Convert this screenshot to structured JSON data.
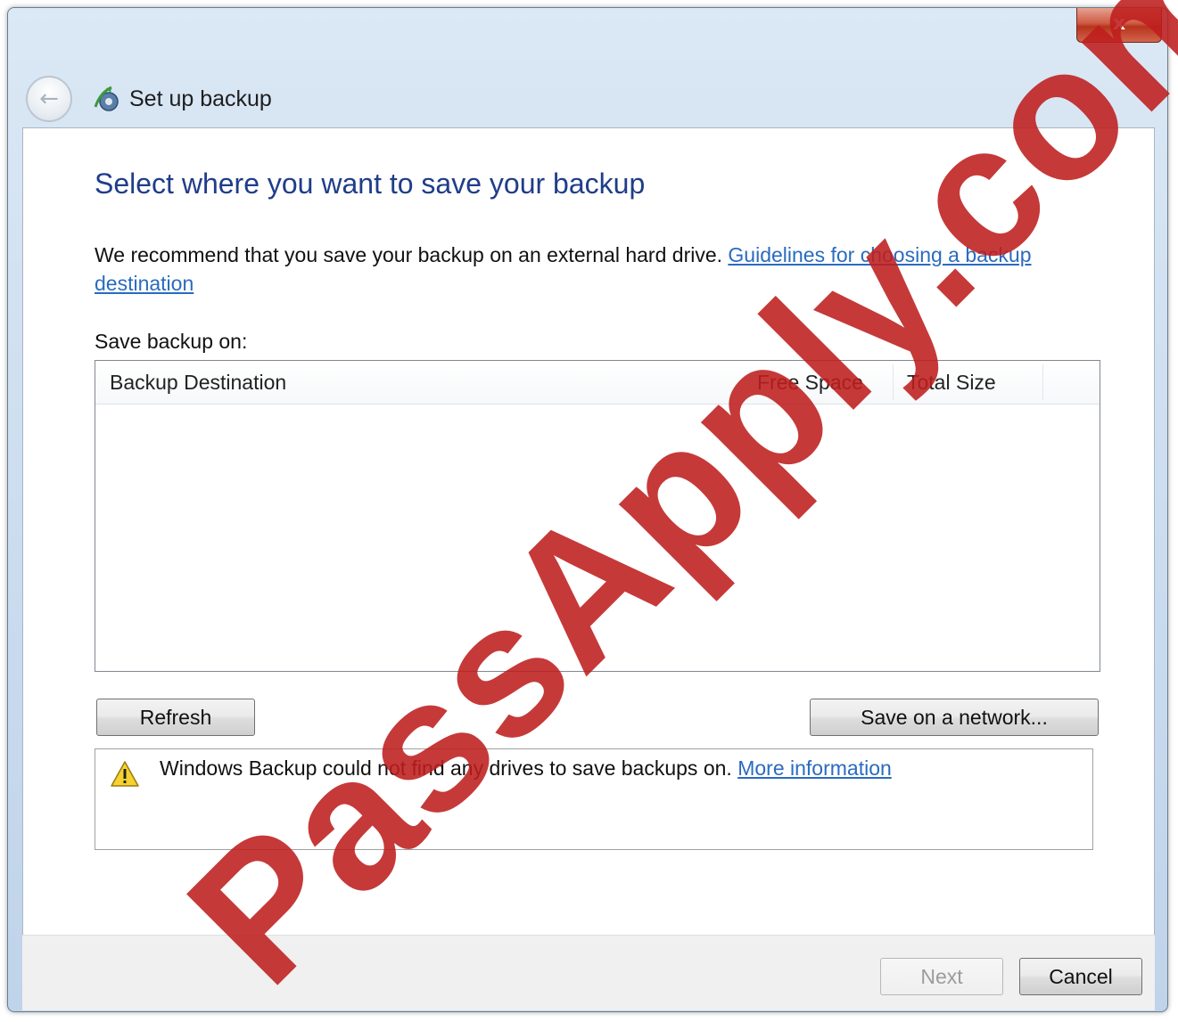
{
  "window": {
    "title": "Set up backup",
    "close_label": "x"
  },
  "page": {
    "heading": "Select where you want to save your backup",
    "recommend_text": "We recommend that you save your backup on an external hard drive. ",
    "guidelines_link": "Guidelines for choosing a backup destination",
    "save_on_label": "Save backup on:"
  },
  "table": {
    "columns": [
      "Backup Destination",
      "Free Space",
      "Total Size"
    ],
    "rows": []
  },
  "buttons": {
    "refresh": "Refresh",
    "save_network": "Save on a network...",
    "next": "Next",
    "cancel": "Cancel"
  },
  "warning": {
    "text": "Windows Backup could not find any drives to save backups on. ",
    "link": "More information",
    "icon": "warning-icon"
  },
  "watermark": {
    "text": "PassApply.com"
  },
  "colors": {
    "heading": "#1f3d8a",
    "link": "#2a6bbf",
    "watermark": "#be1e1e"
  }
}
